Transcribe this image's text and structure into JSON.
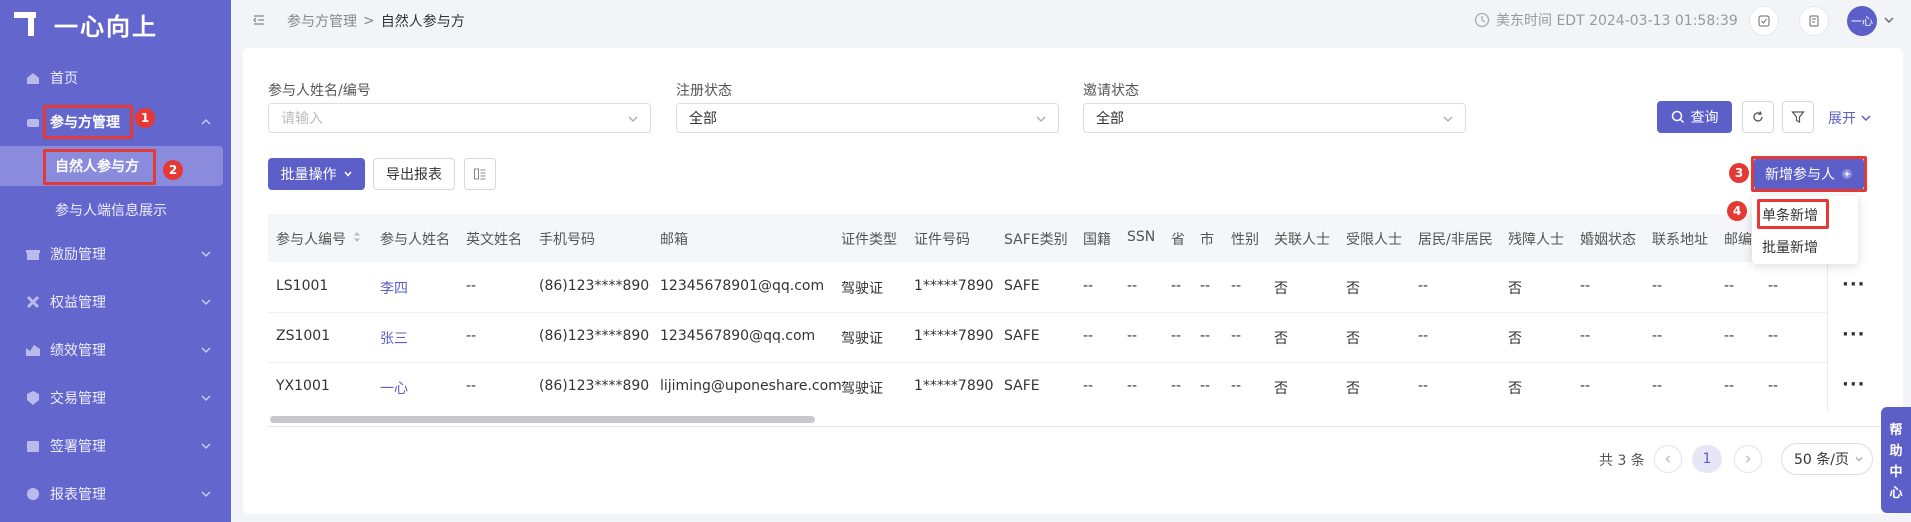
{
  "app": {
    "logo_text": "一心向上"
  },
  "sidebar": {
    "items": [
      {
        "label": "首页",
        "icon": "home-icon"
      },
      {
        "label": "参与方管理",
        "icon": "people-icon"
      },
      {
        "label": "激励管理",
        "icon": "gift-icon"
      },
      {
        "label": "权益管理",
        "icon": "equity-icon"
      },
      {
        "label": "绩效管理",
        "icon": "chart-icon"
      },
      {
        "label": "交易管理",
        "icon": "trade-icon"
      },
      {
        "label": "签署管理",
        "icon": "sign-icon"
      },
      {
        "label": "报表管理",
        "icon": "report-icon"
      }
    ],
    "sub_items": [
      {
        "label": "自然人参与方"
      },
      {
        "label": "参与人端信息展示"
      }
    ]
  },
  "header": {
    "breadcrumb": [
      "参与方管理",
      "自然人参与方"
    ],
    "time_label": "美东时间 EDT 2024-03-13 01:58:39",
    "avatar_text": "一心"
  },
  "filters": {
    "name_label": "参与人姓名/编号",
    "name_placeholder": "请输入",
    "reg_label": "注册状态",
    "reg_value": "全部",
    "invite_label": "邀请状态",
    "invite_value": "全部",
    "query_label": "查询",
    "expand_label": "展开"
  },
  "toolbar": {
    "batch_label": "批量操作",
    "export_label": "导出报表",
    "add_label": "新增参与人",
    "dropdown": [
      "单条新增",
      "批量新增"
    ]
  },
  "table": {
    "columns": [
      "参与人编号",
      "参与人姓名",
      "英文姓名",
      "手机号码",
      "邮箱",
      "证件类型",
      "证件号码",
      "SAFE类别",
      "国籍",
      "SSN",
      "省",
      "市",
      "性别",
      "关联人士",
      "受限人士",
      "居民/非居民",
      "残障人士",
      "婚姻状态",
      "联系地址",
      "邮编"
    ],
    "rows": [
      [
        "LS1001",
        "李四",
        "--",
        "(86)123****890",
        "12345678901@qq.com",
        "驾驶证",
        "1*****7890",
        "SAFE",
        "--",
        "--",
        "--",
        "--",
        "--",
        "否",
        "否",
        "--",
        "否",
        "--",
        "--",
        "--",
        "--"
      ],
      [
        "ZS1001",
        "张三",
        "--",
        "(86)123****890",
        "1234567890@qq.com",
        "驾驶证",
        "1*****7890",
        "SAFE",
        "--",
        "--",
        "--",
        "--",
        "--",
        "否",
        "否",
        "--",
        "否",
        "--",
        "--",
        "--",
        "--"
      ],
      [
        "YX1001",
        "一心",
        "--",
        "(86)123****890",
        "lijiming@uponeshare.com",
        "驾驶证",
        "1*****7890",
        "SAFE",
        "--",
        "--",
        "--",
        "--",
        "--",
        "否",
        "否",
        "--",
        "否",
        "--",
        "--",
        "--",
        "--"
      ]
    ],
    "more_label": "···"
  },
  "pagination": {
    "total_label": "共 3 条",
    "current": "1",
    "page_size": "50 条/页"
  },
  "help": {
    "chars": [
      "帮",
      "助",
      "中",
      "心"
    ]
  },
  "annotations": [
    "1",
    "2",
    "3",
    "4"
  ],
  "colors": {
    "brand": "#6366cc",
    "accent": "#5b5fc7",
    "highlight": "#e53935"
  }
}
